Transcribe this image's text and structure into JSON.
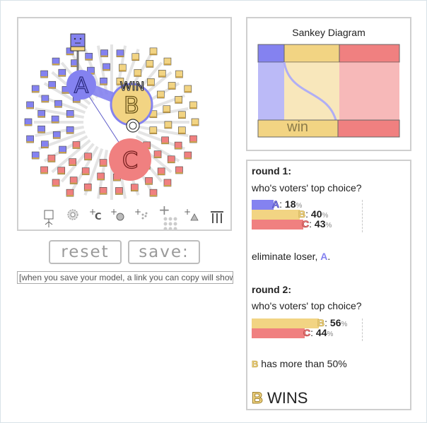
{
  "colors": {
    "A": "#8482f0",
    "B": "#f2d483",
    "C": "#f08080",
    "B_outline": "#b89a3a"
  },
  "sim": {
    "winner_label": "WIN",
    "candidates": [
      {
        "id": "A",
        "label": "A",
        "color": "#8482f0"
      },
      {
        "id": "B",
        "label": "B",
        "color": "#f2d483"
      },
      {
        "id": "C",
        "label": "C",
        "color": "#f08080"
      }
    ],
    "tools": [
      {
        "name": "voter-tool-icon"
      },
      {
        "name": "gear-tool-icon"
      },
      {
        "name": "add-candidate-icon",
        "label": "C"
      },
      {
        "name": "add-voter-icon"
      },
      {
        "name": "add-voter-crowd-icon"
      },
      {
        "name": "add-many-voters-icon"
      },
      {
        "name": "add-triangle-icon"
      },
      {
        "name": "columns-icon"
      }
    ]
  },
  "buttons": {
    "reset": "reset",
    "save": "save:"
  },
  "link_field": {
    "value": "[when you save your model, a link you can copy will show"
  },
  "sankey": {
    "title": "Sankey Diagram",
    "bottom_label": "win"
  },
  "results": {
    "round1_title": "round 1:",
    "round1_question": "who's voters' top choice?",
    "round1_rows": [
      {
        "letter": "A",
        "value": "18",
        "color": "#8482f0"
      },
      {
        "letter": "B",
        "value": "40",
        "color": "#f2d483"
      },
      {
        "letter": "C",
        "value": "43",
        "color": "#f08080"
      }
    ],
    "eliminate_prefix": "eliminate loser,",
    "eliminate_letter": "A",
    "eliminate_suffix": ".",
    "round2_title": "round 2:",
    "round2_question": "who's voters' top choice?",
    "round2_rows": [
      {
        "letter": "B",
        "value": "56",
        "color": "#f2d483"
      },
      {
        "letter": "C",
        "value": "44",
        "color": "#f08080"
      }
    ],
    "majority_letter": "B",
    "majority_text": "has more than 50%",
    "winner_letter": "B",
    "winner_text": "WINS",
    "percent_sign": "%"
  }
}
